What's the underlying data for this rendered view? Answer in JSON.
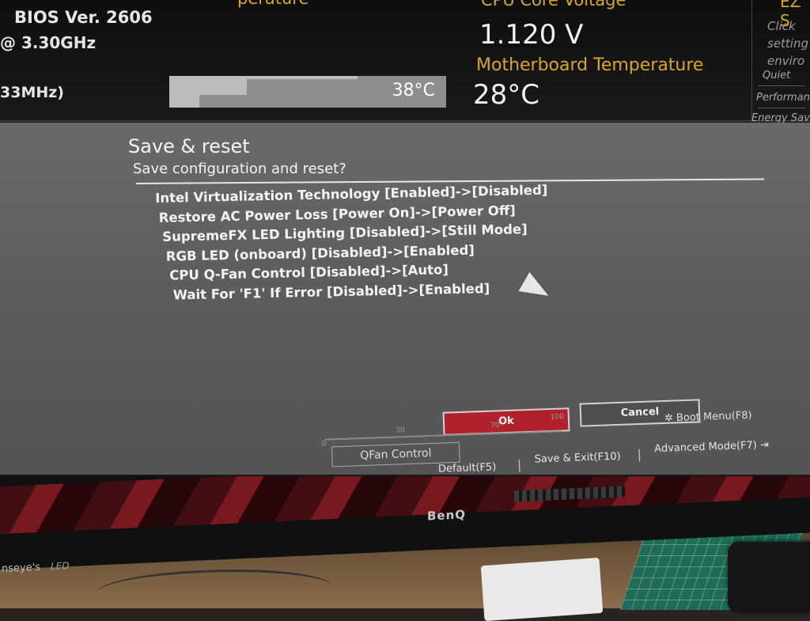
{
  "header": {
    "bios_version": "BIOS Ver. 2606",
    "cpu_speed": "@ 3.30GHz",
    "memory_speed": "33MHz)",
    "cpu_temperature_title": "perature",
    "cpu_temperature_value": "38°C",
    "cpu_voltage_title": "CPU Core Voltage",
    "cpu_voltage_value": "1.120 V",
    "motherboard_temperature_title": "Motherboard Temperature",
    "motherboard_temperature_value": "28°C",
    "ez_title": "EZ S",
    "ez_description": "Click setting enviro",
    "ez_options": [
      "Quiet",
      "Performan",
      "Energy Sav"
    ]
  },
  "dialog": {
    "title": "Save & reset",
    "subtitle": "Save configuration and reset?",
    "changes": [
      "Intel Virtualization Technology [Enabled]->[Disabled]",
      "Restore AC Power Loss [Power On]->[Power Off]",
      "SupremeFX LED Lighting [Disabled]->[Still Mode]",
      "RGB LED (onboard) [Disabled]->[Enabled]",
      "CPU Q-Fan Control [Disabled]->[Auto]",
      "Wait For 'F1' If Error [Disabled]->[Enabled]"
    ],
    "ok_label": "Ok",
    "cancel_label": "Cancel"
  },
  "footer": {
    "fan_ticks": [
      "0",
      "30",
      "70",
      "100"
    ],
    "qfan_label": "QFan Control",
    "boot_menu_label": "Boot Menu(F8)",
    "default_label": "Default(F5)",
    "save_exit_label": "Save & Exit(F10)",
    "advanced_label": "Advanced Mode(F7)",
    "separator": "|"
  },
  "monitor": {
    "brand": "BenQ",
    "left_label": "nseye's",
    "led_label": "LED"
  },
  "colors": {
    "accent_yellow": "#d7a72a",
    "ok_red": "#b0212b",
    "dialog_gray": "#606060"
  }
}
